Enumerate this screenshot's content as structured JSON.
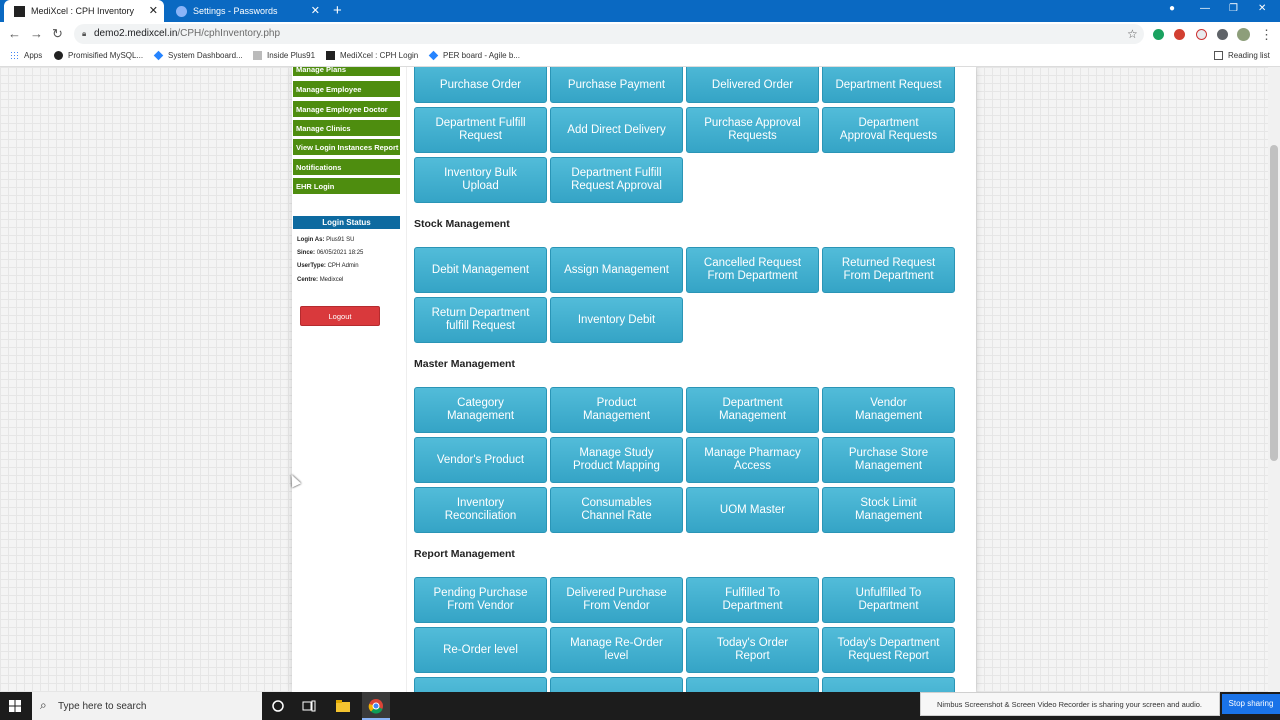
{
  "browser": {
    "tabs": [
      {
        "title": "MediXcel : CPH Inventory"
      },
      {
        "title": "Settings - Passwords"
      }
    ],
    "url_domain": "demo2.medixcel.in",
    "url_path": "/CPH/cphInventory.php",
    "bookmarks": [
      "Apps",
      "Promisified MySQL...",
      "System Dashboard...",
      "Inside Plus91",
      "MediXcel : CPH Login",
      "PER board - Agile b..."
    ],
    "reading_list": "Reading list"
  },
  "sidebar": {
    "items": [
      "Manage Plans",
      "Manage Employee",
      "Manage Employee Doctor",
      "Manage Clinics",
      "View Login Instances Report",
      "Notifications",
      "EHR Login"
    ],
    "login_status": {
      "title": "Login Status",
      "login_as_label": "Login As:",
      "login_as": "Plus91 SU",
      "since_label": "Since:",
      "since": "06/05/2021 18:25",
      "usertype_label": "UserType:",
      "usertype": "CPH Admin",
      "centre_label": "Centre:",
      "centre": "Medixcel"
    },
    "logout_label": "Logout"
  },
  "sections": {
    "purchase": {
      "tiles": [
        "Purchase Order",
        "Purchase Payment",
        "Delivered Order",
        "Department Request",
        "Department Fulfill\nRequest",
        "Add Direct Delivery",
        "Purchase Approval\nRequests",
        "Department\nApproval Requests",
        "Inventory Bulk\nUpload",
        "Department Fulfill\nRequest Approval"
      ]
    },
    "stock": {
      "title": "Stock Management",
      "tiles": [
        "Debit Management",
        "Assign Management",
        "Cancelled Request\nFrom Department",
        "Returned Request\nFrom Department",
        "Return Department\nfulfill Request",
        "Inventory Debit"
      ]
    },
    "master": {
      "title": "Master Management",
      "tiles": [
        "Category\nManagement",
        "Product\nManagement",
        "Department\nManagement",
        "Vendor\nManagement",
        "Vendor's Product",
        "Manage Study\nProduct Mapping",
        "Manage Pharmacy\nAccess",
        "Purchase Store\nManagement",
        "Inventory\nReconciliation",
        "Consumables\nChannel Rate",
        "UOM Master",
        "Stock Limit\nManagement"
      ]
    },
    "report": {
      "title": "Report Management",
      "tiles": [
        "Pending Purchase\nFrom Vendor",
        "Delivered Purchase\nFrom Vendor",
        "Fulfilled To\nDepartment",
        "Unfulfilled To\nDepartment",
        "Re-Order level",
        "Manage Re-Order\nlevel",
        "Today's Order\nReport",
        "Today's Department\nRequest Report"
      ]
    }
  },
  "taskbar": {
    "search_placeholder": "Type here to search"
  },
  "notification": {
    "message": "Nimbus Screenshot & Screen Video Recorder is sharing your screen and audio.",
    "stop_label": "Stop sharing"
  },
  "colors": {
    "tile": "#3fb0d0",
    "sidebar_item": "#4e8d0f",
    "login_title": "#0d6aa0",
    "logout": "#d9393c",
    "chrome_blue": "#0a69c2"
  }
}
